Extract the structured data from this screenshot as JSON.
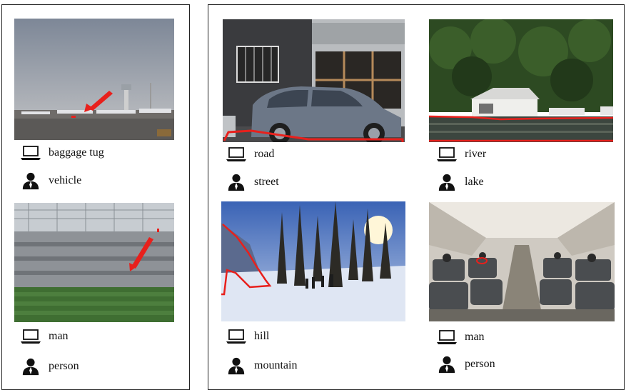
{
  "figure": {
    "left_panel": {
      "examples": [
        {
          "scene": "airport tarmac with aircraft",
          "model_label": "baggage tug",
          "human_label": "vehicle"
        },
        {
          "scene": "empty stadium interior",
          "model_label": "man",
          "human_label": "person"
        }
      ]
    },
    "right_panel": {
      "examples": [
        {
          "scene": "street with parked car",
          "model_label": "road",
          "human_label": "street"
        },
        {
          "scene": "boathouse by the water",
          "model_label": "river",
          "human_label": "lake"
        },
        {
          "scene": "snowy forest with skiers",
          "model_label": "hill",
          "human_label": "mountain"
        },
        {
          "scene": "airplane cabin interior",
          "model_label": "man",
          "human_label": "person"
        }
      ]
    },
    "icons": {
      "model": "laptop-icon",
      "human": "person-icon"
    },
    "colors": {
      "highlight": "#e8201c",
      "border": "#222222"
    }
  }
}
